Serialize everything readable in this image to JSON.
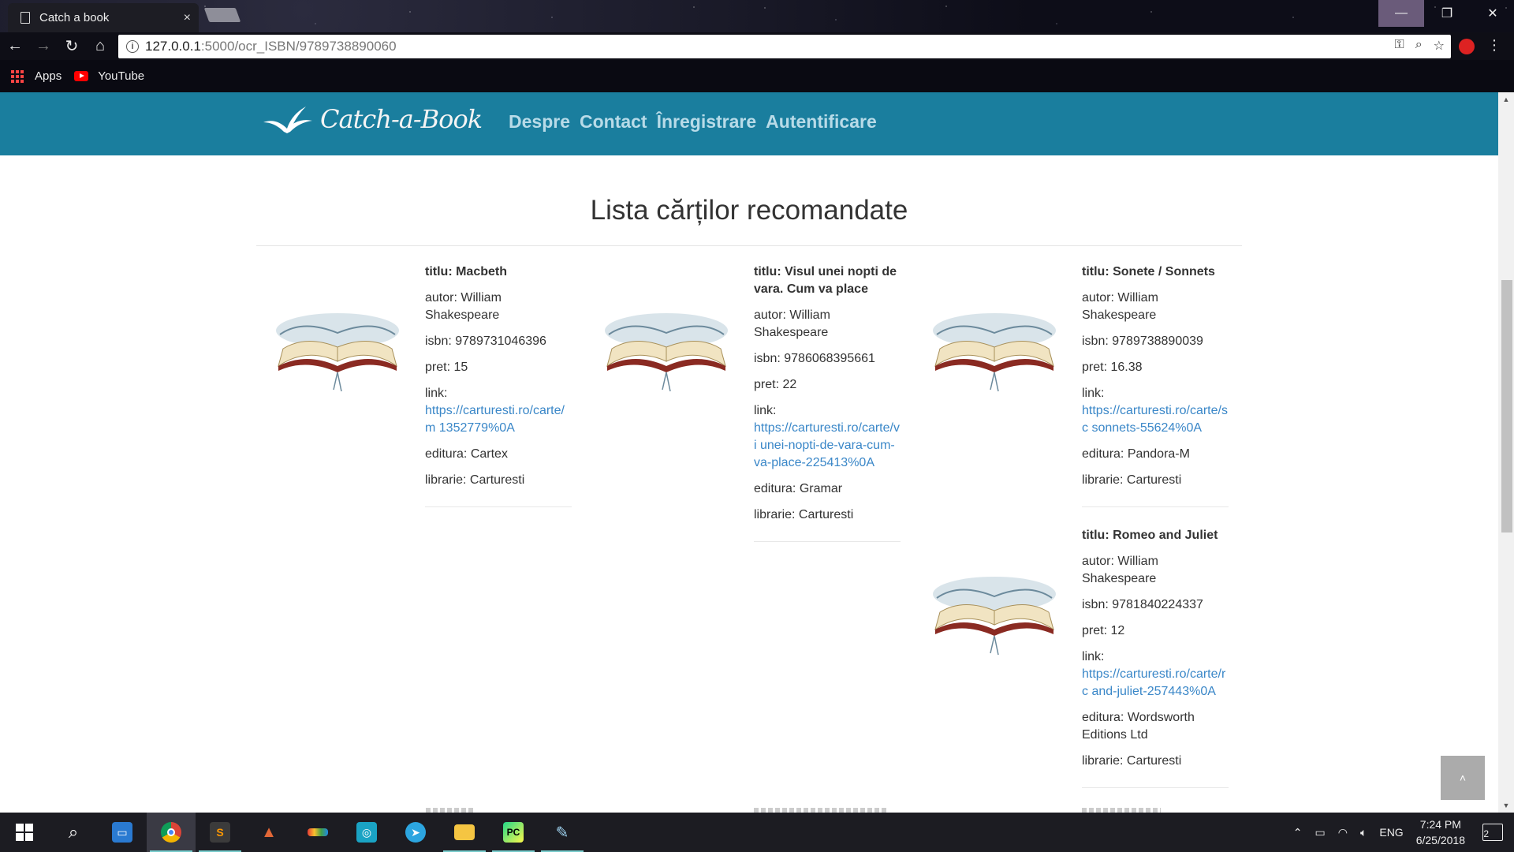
{
  "browser": {
    "tab_title": "Catch a book",
    "tab_close": "×",
    "url_host": "127.0.0.1",
    "url_path": ":5000/ocr_ISBN/9789738890060",
    "bookmarks": [
      {
        "label": "Apps"
      },
      {
        "label": "YouTube"
      }
    ],
    "window_controls": {
      "minimize": "—",
      "maximize": "❐",
      "close": "✕"
    }
  },
  "site": {
    "logo_text": "Catch-a-Book",
    "nav": [
      {
        "label": "Despre"
      },
      {
        "label": "Contact"
      },
      {
        "label": "Înregistrare"
      },
      {
        "label": "Autentificare"
      }
    ],
    "page_title": "Lista cărților recomandate"
  },
  "books": [
    {
      "titlu": "titlu: Macbeth",
      "autor": "autor: William Shakespeare",
      "isbn": "isbn: 9789731046396",
      "pret": "pret: 15",
      "link_label": "link:",
      "link": "https://carturesti.ro/carte/m 1352779%0A",
      "editura": "editura: Cartex",
      "librarie": "librarie: Carturesti"
    },
    {
      "titlu": "titlu: Visul unei nopti de vara. Cum va place",
      "autor": "autor: William Shakespeare",
      "isbn": "isbn: 9786068395661",
      "pret": "pret: 22",
      "link_label": "link:",
      "link": "https://carturesti.ro/carte/vi unei-nopti-de-vara-cum-va-place-225413%0A",
      "editura": "editura: Gramar",
      "librarie": "librarie: Carturesti"
    },
    {
      "titlu": "titlu: Sonete / Sonnets",
      "autor": "autor: William Shakespeare",
      "isbn": "isbn: 9789738890039",
      "pret": "pret: 16.38",
      "link_label": "link:",
      "link": "https://carturesti.ro/carte/sc sonnets-55624%0A",
      "editura": "editura: Pandora-M",
      "librarie": "librarie: Carturesti"
    },
    {
      "titlu": "titlu: Romeo and Juliet",
      "autor": "autor: William Shakespeare",
      "isbn": "isbn: 9781840224337",
      "pret": "pret: 12",
      "link_label": "link:",
      "link": "https://carturesti.ro/carte/rc and-juliet-257443%0A",
      "editura": "editura: Wordsworth Editions Ltd",
      "librarie": "librarie: Carturesti"
    }
  ],
  "back_to_top": "˄",
  "taskbar": {
    "apps": [
      "windows-start",
      "search",
      "file-explorer-desktop",
      "chrome",
      "sublime-text",
      "matlab",
      "app-grid",
      "instagram",
      "telegram",
      "file-explorer",
      "pycharm",
      "paint"
    ],
    "language": "ENG",
    "time": "7:24 PM",
    "date": "6/25/2018",
    "notifications": "2"
  }
}
